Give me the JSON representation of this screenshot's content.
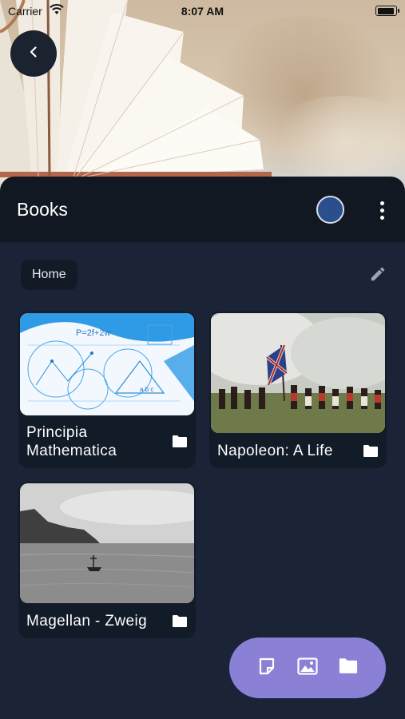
{
  "status_bar": {
    "carrier": "Carrier",
    "time": "8:07 AM",
    "icons": [
      "wifi-icon",
      "battery-icon"
    ]
  },
  "header": {
    "title": "Books",
    "back_icon": "chevron-left-icon",
    "avatar_color": "#2b4f8c",
    "menu_icon": "more-vert-icon"
  },
  "breadcrumb": {
    "items": [
      "Home"
    ],
    "edit_icon": "pencil-icon"
  },
  "books": [
    {
      "title_line1": "Principia",
      "title_line2": "Mathematica",
      "thumbnail": "math-diagram",
      "icon": "folder-icon"
    },
    {
      "title": "Napoleon: A Life",
      "thumbnail": "battle-scene",
      "icon": "folder-icon"
    },
    {
      "title": "Magellan - Zweig",
      "thumbnail": "ship-at-sea",
      "icon": "folder-icon"
    }
  ],
  "fab_actions": [
    {
      "icon": "note-icon"
    },
    {
      "icon": "image-icon"
    },
    {
      "icon": "folder-icon"
    }
  ],
  "colors": {
    "background": "#1a2436",
    "appbar": "#121821",
    "card": "#121b28",
    "fab": "#8a80d6"
  }
}
